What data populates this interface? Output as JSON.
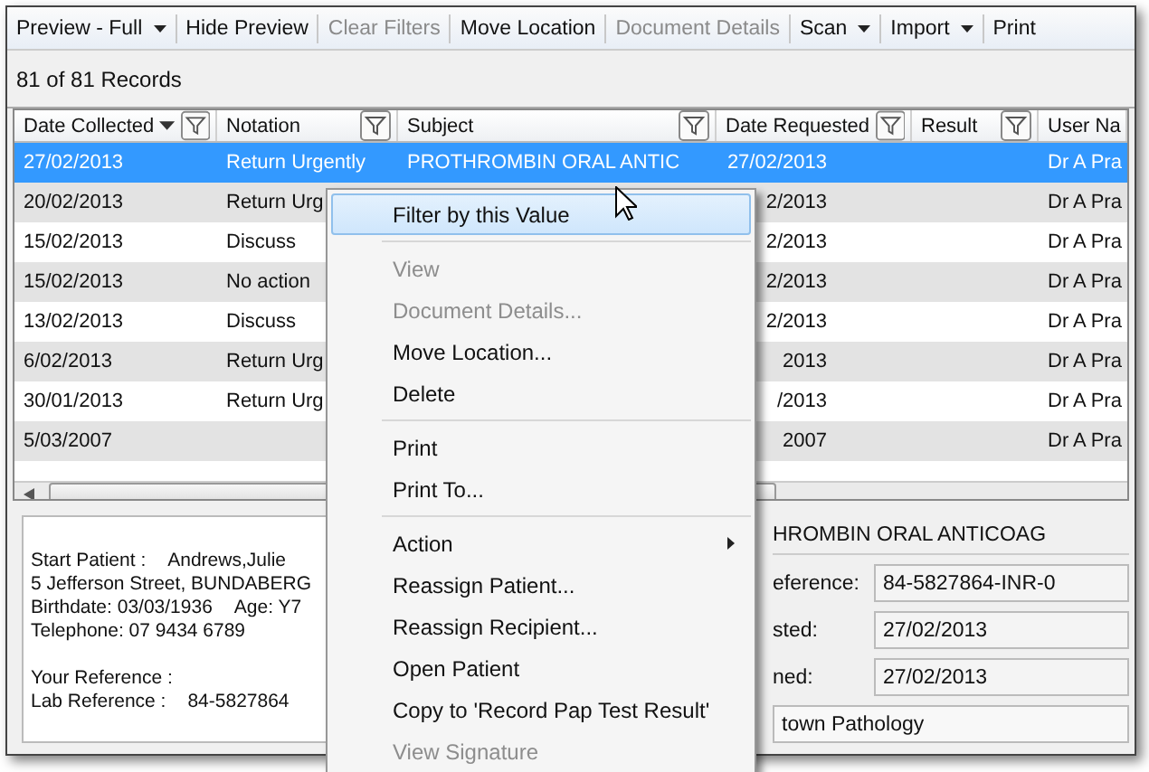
{
  "toolbar": [
    {
      "label": "Preview - Full",
      "dropdown": true,
      "disabled": false
    },
    {
      "label": "Hide Preview",
      "dropdown": false,
      "disabled": false
    },
    {
      "label": "Clear Filters",
      "dropdown": false,
      "disabled": true
    },
    {
      "label": "Move Location",
      "dropdown": false,
      "disabled": false
    },
    {
      "label": "Document Details",
      "dropdown": false,
      "disabled": true
    },
    {
      "label": "Scan",
      "dropdown": true,
      "disabled": false
    },
    {
      "label": "Import",
      "dropdown": true,
      "disabled": false
    },
    {
      "label": "Print",
      "dropdown": false,
      "disabled": false
    }
  ],
  "record_count": "81 of 81 Records",
  "table": {
    "columns": [
      {
        "label": "Date Collected",
        "sorted": true,
        "filter": true
      },
      {
        "label": "Notation",
        "sorted": false,
        "filter": true
      },
      {
        "label": "Subject",
        "sorted": false,
        "filter": true
      },
      {
        "label": "Date Requested",
        "sorted": false,
        "filter": true
      },
      {
        "label": "Result",
        "sorted": false,
        "filter": true
      },
      {
        "label": "User Na"
      }
    ],
    "rows": [
      {
        "date_collected": "27/02/2013",
        "notation": "Return Urgently",
        "subject": "PROTHROMBIN ORAL ANTIC",
        "date_requested": "27/02/2013",
        "user_name": "Dr A Pra",
        "selected": true
      },
      {
        "date_collected": "20/02/2013",
        "notation": "Return Urg",
        "date_requested": "2/2013",
        "user_name": "Dr A Pra",
        "selected": false
      },
      {
        "date_collected": "15/02/2013",
        "notation": "Discuss",
        "date_requested": "2/2013",
        "user_name": "Dr A Pra",
        "selected": false
      },
      {
        "date_collected": "15/02/2013",
        "notation": "No action",
        "date_requested": "2/2013",
        "user_name": "Dr A Pra",
        "selected": false
      },
      {
        "date_collected": "13/02/2013",
        "notation": "Discuss",
        "date_requested": "2/2013",
        "user_name": "Dr A Pra",
        "selected": false
      },
      {
        "date_collected": "6/02/2013",
        "notation": "Return Urg",
        "date_requested": "2013",
        "user_name": "Dr A Pra",
        "selected": false
      },
      {
        "date_collected": "30/01/2013",
        "notation": "Return Urg",
        "date_requested": "/2013",
        "user_name": "Dr A Pra",
        "selected": false
      },
      {
        "date_collected": "5/03/2007",
        "date_requested": "2007",
        "user_name": "Dr A Pra",
        "selected": false
      }
    ]
  },
  "preview": {
    "patient_lines": [
      {
        "label": "Start Patient  :",
        "value": "Andrews,Julie"
      },
      {
        "label": "5 Jefferson Street, BUNDABERG"
      },
      {
        "label": "Birthdate: 03/03/1936",
        "value": "Age: Y7"
      },
      {
        "label": "Telephone: 07 9434 6789"
      }
    ],
    "reference_lines": [
      {
        "label": "Your Reference :"
      },
      {
        "label": "Lab Reference  :",
        "value": "84-5827864"
      }
    ]
  },
  "details": {
    "subject": "HROMBIN ORAL ANTICOAG",
    "fields": [
      {
        "label": "eference:",
        "value": "84-5827864-INR-0"
      },
      {
        "label": "sted:",
        "value": "27/02/2013"
      },
      {
        "label": "ned:",
        "value": "27/02/2013"
      }
    ],
    "lab": "town Pathology"
  },
  "context_menu": [
    {
      "kind": "item",
      "label": "Filter by this Value",
      "selected": true,
      "disabled": false,
      "submenu": false
    },
    {
      "kind": "separator"
    },
    {
      "kind": "item",
      "label": "View",
      "selected": false,
      "disabled": true,
      "submenu": false
    },
    {
      "kind": "item",
      "label": "Document Details...",
      "selected": false,
      "disabled": true,
      "submenu": false
    },
    {
      "kind": "item",
      "label": "Move Location...",
      "selected": false,
      "disabled": false,
      "submenu": false
    },
    {
      "kind": "item",
      "label": "Delete",
      "selected": false,
      "disabled": false,
      "submenu": false
    },
    {
      "kind": "separator"
    },
    {
      "kind": "item",
      "label": "Print",
      "selected": false,
      "disabled": false,
      "submenu": false
    },
    {
      "kind": "item",
      "label": "Print To...",
      "selected": false,
      "disabled": false,
      "submenu": false
    },
    {
      "kind": "separator"
    },
    {
      "kind": "item",
      "label": "Action",
      "selected": false,
      "disabled": false,
      "submenu": true
    },
    {
      "kind": "item",
      "label": "Reassign Patient...",
      "selected": false,
      "disabled": false,
      "submenu": false
    },
    {
      "kind": "item",
      "label": "Reassign Recipient...",
      "selected": false,
      "disabled": false,
      "submenu": false
    },
    {
      "kind": "item",
      "label": "Open Patient",
      "selected": false,
      "disabled": false,
      "submenu": false
    },
    {
      "kind": "item",
      "label": "Copy to 'Record Pap Test Result'",
      "selected": false,
      "disabled": false,
      "submenu": false
    },
    {
      "kind": "item",
      "label": "View Signature",
      "selected": false,
      "disabled": true,
      "submenu": false
    }
  ]
}
